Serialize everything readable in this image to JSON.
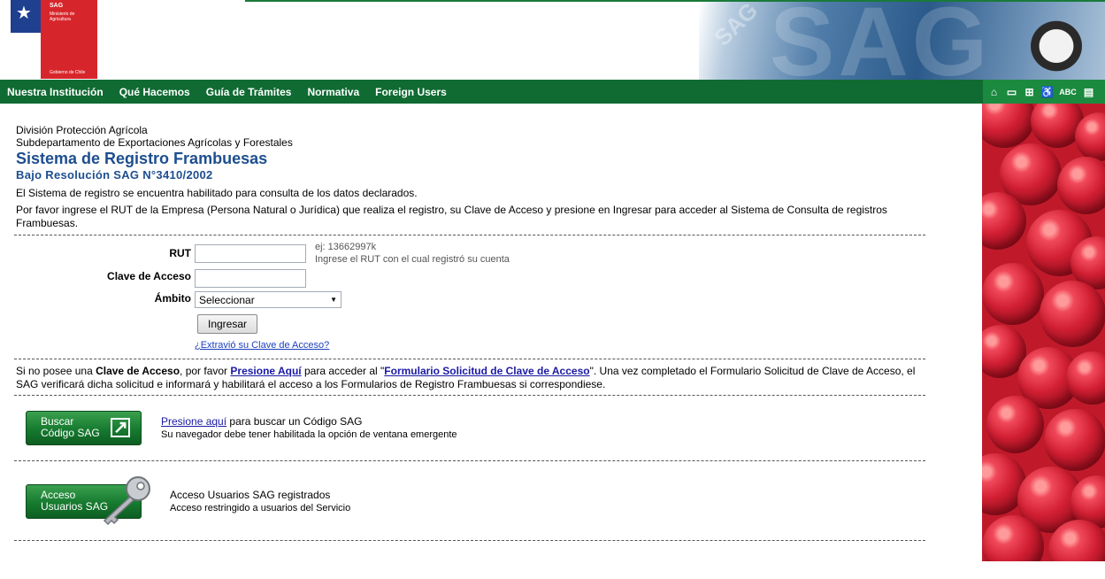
{
  "header": {
    "logo": {
      "org": "SAG",
      "ministry": "Ministerio de Agricultura",
      "government": "Gobierno de Chile"
    },
    "photo_watermark": "SAG"
  },
  "nav": {
    "items": [
      "Nuestra Institución",
      "Qué Hacemos",
      "Guía de Trámites",
      "Normativa",
      "Foreign Users"
    ],
    "tools": [
      "home-icon",
      "contact-card-icon",
      "sitemap-icon",
      "accessibility-icon",
      "ABC",
      "book-icon"
    ],
    "tools_abc_label": "ABC"
  },
  "page": {
    "division": "División Protección Agrícola",
    "subdepartment": "Subdepartamento de Exportaciones Agrícolas y Forestales",
    "title": "Sistema de Registro Frambuesas",
    "subtitle": "Bajo Resolución SAG N°3410/2002",
    "status_text": "El Sistema de registro se encuentra habilitado para consulta de los datos declarados.",
    "instructions": "Por favor ingrese el RUT de la Empresa (Persona Natural o Jurídica) que realiza el registro, su Clave de Acceso y presione en Ingresar para acceder al Sistema de Consulta de registros Frambuesas."
  },
  "form": {
    "rut_label": "RUT",
    "rut_value": "",
    "rut_hint_example": "ej: 13662997k",
    "rut_hint_text": "Ingrese el RUT con el cual registró su cuenta",
    "password_label": "Clave de Acceso",
    "password_value": "",
    "scope_label": "Ámbito",
    "scope_selected": "Seleccionar",
    "submit_label": "Ingresar",
    "forgot_link": "¿Extravió su Clave de Acceso?"
  },
  "request_info": {
    "part1": "Si no posee una ",
    "bold_term": "Clave de Acceso",
    "part2": ", por favor ",
    "link1": "Presione Aquí",
    "part3": " para acceder al \"",
    "link2": "Formulario Solicitud de Clave de Acceso",
    "part4": "\". Una vez completado el Formulario Solicitud de Clave de Acceso, el SAG verificará dicha solicitud e informará y habilitará el acceso a los Formularios de Registro Frambuesas si correspondiese."
  },
  "search_code": {
    "button_line1": "Buscar",
    "button_line2": "Código SAG",
    "link": "Presione aquí",
    "text": " para buscar un Código SAG",
    "note": "Su navegador debe tener habilitada la opción de ventana emergente"
  },
  "sag_users": {
    "button_line1": "Acceso",
    "button_line2": "Usuarios SAG",
    "title": "Acceso Usuarios SAG registrados",
    "note": "Acceso restringido a usuarios del Servicio"
  },
  "colors": {
    "nav_green": "#0f6b32",
    "title_blue": "#1d4e8f",
    "logo_red": "#d7262b",
    "logo_blue": "#1f3f8f",
    "button_green": "#167a2f"
  }
}
